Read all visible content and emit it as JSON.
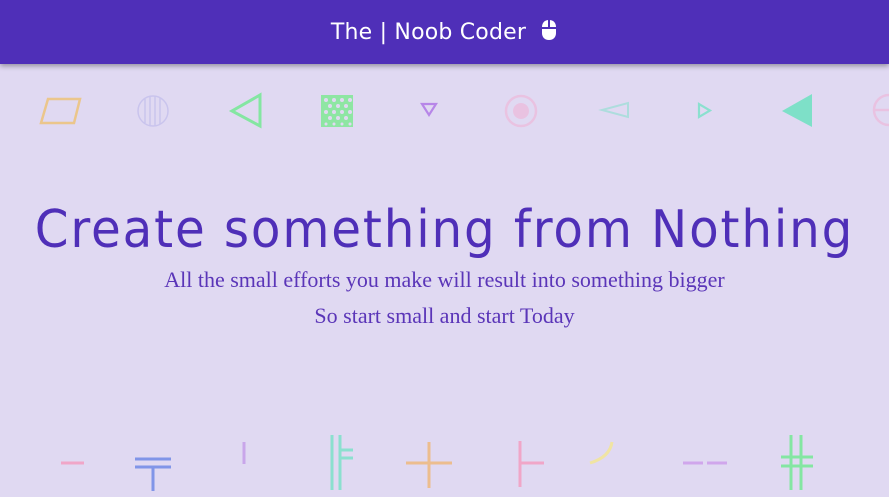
{
  "navbar": {
    "title": "The | Noob Coder",
    "icon": "mouse-icon",
    "background": "#4f2fb8"
  },
  "hero": {
    "title": "Create something from Nothing",
    "line1": "All the small efforts you make will result into something bigger",
    "line2": "So start small and start Today"
  },
  "decorations": {
    "top_shapes": [
      "parallelogram-icon",
      "striped-circle-icon",
      "triangle-left-outline-icon",
      "dotted-square-icon",
      "small-triangle-down-icon",
      "ring-icon",
      "thin-triangle-left-icon",
      "small-triangle-right-icon",
      "triangle-left-filled-icon",
      "half-circle-icon"
    ],
    "bottom_shapes": [
      "dash-icon",
      "double-bar-t-icon",
      "short-bar-icon",
      "double-bracket-icon",
      "plus-icon",
      "tee-icon",
      "arc-icon",
      "double-dash-icon",
      "hash-icon"
    ]
  },
  "colors": {
    "background": "#e0d9f2",
    "accent": "#4f2fb8"
  }
}
